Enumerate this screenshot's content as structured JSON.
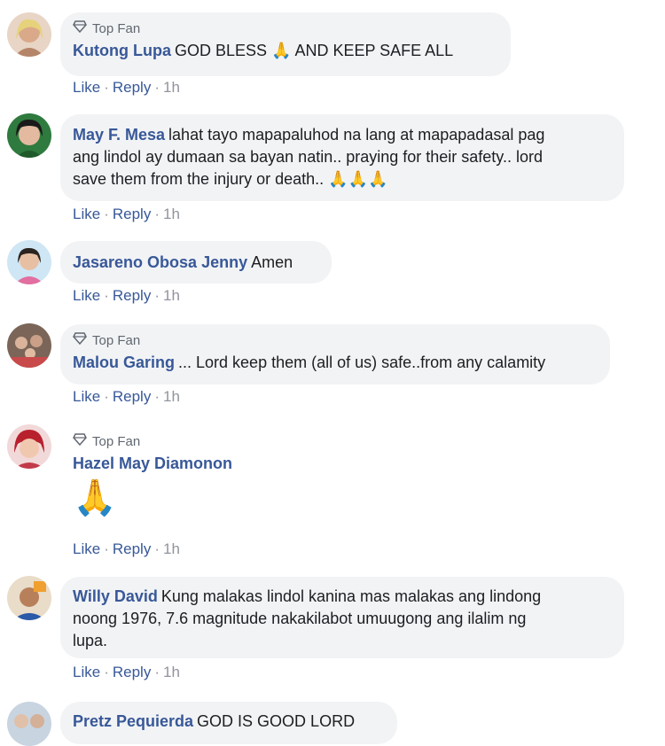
{
  "actions": {
    "like": "Like",
    "reply": "Reply",
    "dot": "·"
  },
  "comments": [
    {
      "badge": "Top Fan",
      "name": "Kutong Lupa",
      "text": "GOD BLESS 🙏 AND KEEP SAFE ALL",
      "time": "1h",
      "avatar_color": "#c9a28a"
    },
    {
      "badge": "",
      "name": "May F. Mesa",
      "text_line1": "lahat tayo mapapaluhod na lang at mapapadasal pag",
      "text_line2": "ang lindol ay dumaan sa bayan natin.. praying for their safety.. lord",
      "text_line3": "save them from the injury or death.. 🙏🙏🙏",
      "time": "1h",
      "avatar_color": "#3c8a4a"
    },
    {
      "badge": "",
      "name": "Jasareno Obosa Jenny",
      "text": "Amen",
      "time": "1h",
      "avatar_color": "#b7d8f0"
    },
    {
      "badge": "Top Fan",
      "name": "Malou Garing",
      "text": "... Lord keep them (all of us) safe..from any calamity",
      "time": "1h",
      "avatar_color": "#8a6a5a"
    },
    {
      "badge": "Top Fan",
      "name": "Hazel May Diamonon",
      "emoji": "🙏",
      "time": "1h",
      "avatar_color": "#c23a4a"
    },
    {
      "badge": "",
      "name": "Willy David",
      "text_line1": "Kung malakas lindol kanina mas malakas ang lindong",
      "text_line2": "noong 1976, 7.6 magnitude nakakilabot umuugong ang ilalim ng",
      "text_line3": "lupa.",
      "time": "1h",
      "avatar_color": "#d8b890"
    },
    {
      "badge": "",
      "name": "Pretz Pequierda",
      "text": "GOD IS GOOD LORD",
      "avatar_color": "#a8b8c8"
    }
  ]
}
